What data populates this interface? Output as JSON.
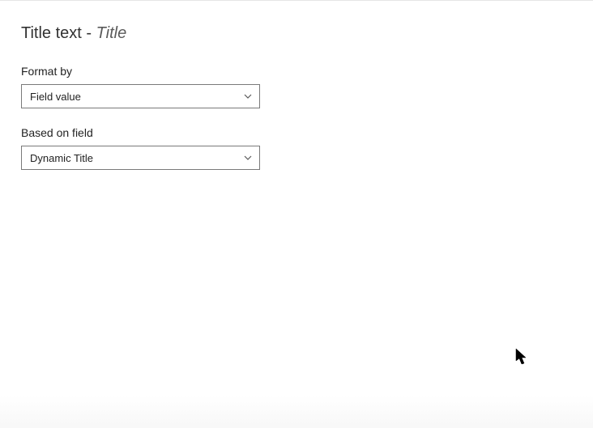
{
  "header": {
    "prefix": "Title text - ",
    "suffix": "Title"
  },
  "fields": {
    "format_by": {
      "label": "Format by",
      "value": "Field value"
    },
    "based_on_field": {
      "label": "Based on field",
      "value": "Dynamic Title"
    }
  }
}
